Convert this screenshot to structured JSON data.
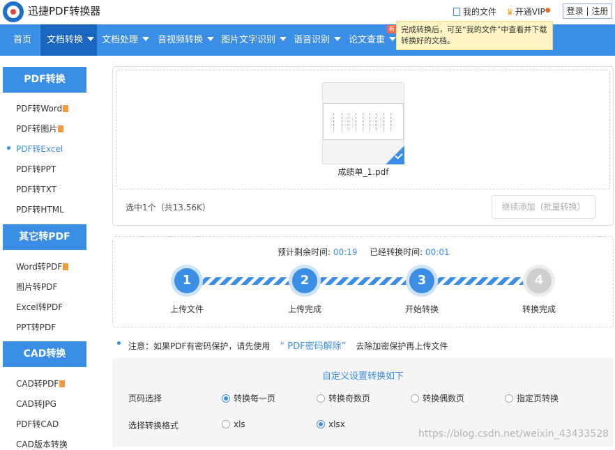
{
  "header": {
    "app_title": "迅捷PDF转换器",
    "my_files": "我的文件",
    "vip": "开通VIP",
    "login": "登录",
    "separator": "|",
    "register": "注册"
  },
  "nav": {
    "items": [
      {
        "label": "首页"
      },
      {
        "label": "文档转换"
      },
      {
        "label": "文档处理"
      },
      {
        "label": "音视频转换"
      },
      {
        "label": "图片文字识别"
      },
      {
        "label": "语音识别"
      },
      {
        "label": "论文查重"
      }
    ],
    "new_badge": "新",
    "tooltip": "完成转换后，可至“我的文件”中查看并下载转换好的文档。"
  },
  "sidebar": {
    "sections": [
      {
        "title": "PDF转换",
        "items": [
          "PDF转Word",
          "PDF转图片",
          "PDF转Excel",
          "PDF转PPT",
          "PDF转TXT",
          "PDF转HTML"
        ]
      },
      {
        "title": "其它转PDF",
        "items": [
          "Word转PDF",
          "图片转PDF",
          "Excel转PDF",
          "PPT转PDF"
        ]
      },
      {
        "title": "CAD转换",
        "items": [
          "CAD转PDF",
          "CAD转JPG",
          "PDF转CAD",
          "CAD版本转换"
        ]
      }
    ]
  },
  "upload": {
    "file_name": "成绩单_1.pdf",
    "selection_info": "选中1个（共13.56K）",
    "add_button": "继续添加（批量转换）"
  },
  "progress": {
    "remaining_label": "预计剩余时间:",
    "remaining_value": "00:19",
    "elapsed_label": "已经转换时间:",
    "elapsed_value": "00:01",
    "steps": [
      {
        "num": "1",
        "label": "上传文件"
      },
      {
        "num": "2",
        "label": "上传完成"
      },
      {
        "num": "3",
        "label": "开始转换"
      },
      {
        "num": "4",
        "label": "转换完成"
      }
    ]
  },
  "notice": {
    "prefix": "注意：如果PDF有密码保护，请先使用",
    "link": "“ PDF密码解除”",
    "suffix": "去除加密保护再上传文件"
  },
  "settings": {
    "title": "自定义设置转换如下",
    "page_label": "页码选择",
    "page_options": [
      "转换每一页",
      "转换奇数页",
      "转换偶数页",
      "指定页转换"
    ],
    "page_selected": "转换每一页",
    "format_label": "选择转换格式",
    "format_options": [
      "xls",
      "xlsx"
    ],
    "format_selected": "xlsx"
  },
  "watermark": "https://blog.csdn.net/weixin_43433528"
}
